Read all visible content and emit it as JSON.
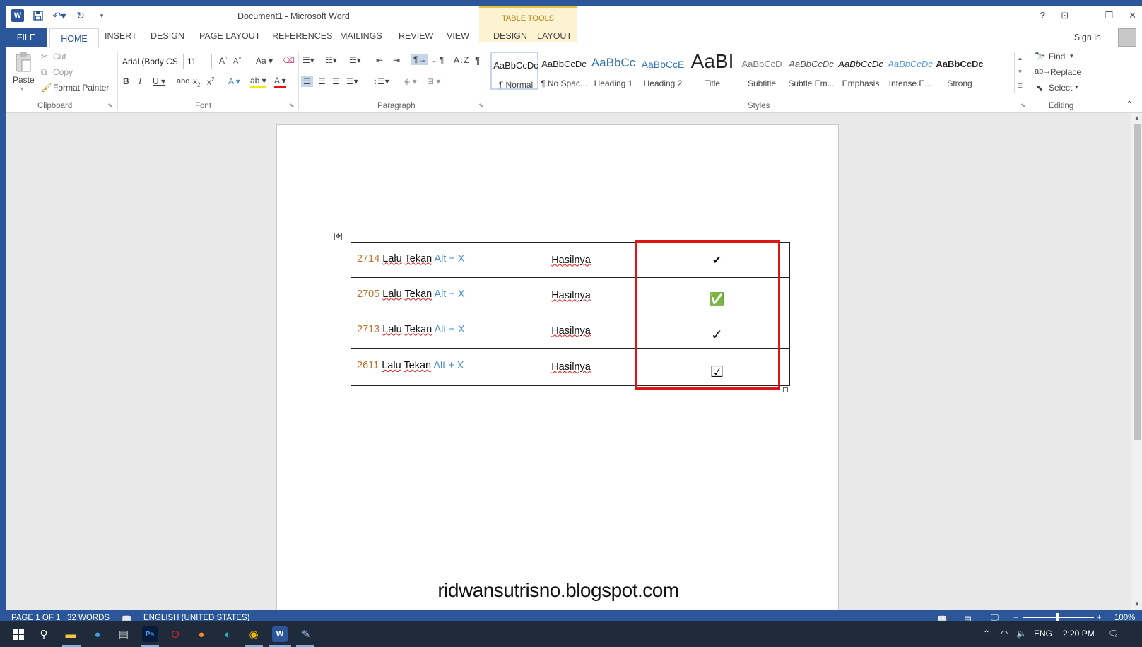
{
  "title_bar": {
    "doc_title": "Document1 - Microsoft Word",
    "context_header": "TABLE TOOLS",
    "help": "?",
    "ribbon_display": "⊡",
    "minimize": "–",
    "restore": "❐",
    "close": "✕"
  },
  "tabs": {
    "file": "FILE",
    "home": "HOME",
    "insert": "INSERT",
    "design": "DESIGN",
    "page_layout": "PAGE LAYOUT",
    "references": "REFERENCES",
    "mailings": "MAILINGS",
    "review": "REVIEW",
    "view": "VIEW",
    "table_design": "DESIGN",
    "table_layout": "LAYOUT",
    "sign_in": "Sign in"
  },
  "clipboard": {
    "paste": "Paste",
    "cut": "Cut",
    "copy": "Copy",
    "format_painter": "Format Painter",
    "label": "Clipboard"
  },
  "font": {
    "font_name": "Arial (Body CS",
    "font_size": "11",
    "change_case": "Aa",
    "label": "Font"
  },
  "paragraph": {
    "label": "Paragraph"
  },
  "styles": {
    "label": "Styles",
    "items": [
      {
        "sample": "AaBbCcDc",
        "name": "¶ Normal"
      },
      {
        "sample": "AaBbCcDc",
        "name": "¶ No Spac..."
      },
      {
        "sample": "AaBbCc",
        "name": "Heading 1"
      },
      {
        "sample": "AaBbCcE",
        "name": "Heading 2"
      },
      {
        "sample": "AaBI",
        "name": "Title"
      },
      {
        "sample": "AaBbCcD",
        "name": "Subtitle"
      },
      {
        "sample": "AaBbCcDc",
        "name": "Subtle Em..."
      },
      {
        "sample": "AaBbCcDc",
        "name": "Emphasis"
      },
      {
        "sample": "AaBbCcDc",
        "name": "Intense E..."
      },
      {
        "sample": "AaBbCcDc",
        "name": "Strong"
      }
    ]
  },
  "editing": {
    "find": "Find",
    "replace": "Replace",
    "select": "Select",
    "label": "Editing"
  },
  "document": {
    "rows": [
      {
        "code": "2714",
        "lalu": "Lalu",
        "tekan": "Tekan",
        "keys": "Alt + X",
        "result_label": "Hasilnya",
        "symbol": "✔"
      },
      {
        "code": "2705",
        "lalu": "Lalu",
        "tekan": "Tekan",
        "keys": "Alt + X",
        "result_label": "Hasilnya",
        "symbol": "✅"
      },
      {
        "code": "2713",
        "lalu": "Lalu",
        "tekan": "Tekan",
        "keys": "Alt + X",
        "result_label": "Hasilnya",
        "symbol": "✓"
      },
      {
        "code": "2611",
        "lalu": "Lalu",
        "tekan": "Tekan",
        "keys": "Alt + X",
        "result_label": "Hasilnya",
        "symbol": "☑"
      }
    ],
    "watermark": "ridwansutrisno.blogspot.com"
  },
  "status_bar": {
    "page": "PAGE 1 OF 1",
    "words": "32 WORDS",
    "language": "ENGLISH (UNITED STATES)",
    "zoom": "100%"
  },
  "taskbar": {
    "language": "ENG",
    "time": "2:20 PM"
  },
  "colors": {
    "word_blue": "#2b579a",
    "highlight_red": "#e01414",
    "code_orange": "#c0732b",
    "key_blue": "#4a90c8"
  }
}
